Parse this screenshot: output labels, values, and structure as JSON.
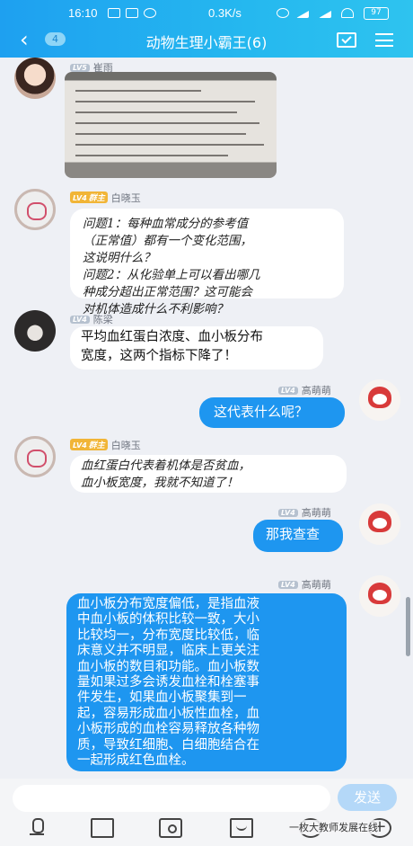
{
  "status_bar": {
    "time": "16:10",
    "network_speed": "0.3K/s",
    "battery": "97"
  },
  "header": {
    "back_icon": "chevron-left-icon",
    "unread_count": "4",
    "title": "动物生理小霸王(6)",
    "calendar_icon": "calendar-check-icon",
    "menu_icon": "menu-icon"
  },
  "messages": [
    {
      "id": "m1",
      "direction": "in",
      "level": "LV5",
      "sender": "崔雨",
      "type": "image"
    },
    {
      "id": "m2",
      "direction": "in",
      "level": "LV4",
      "role": "群主",
      "sender": "白晓玉",
      "lines": [
        "问题1：每种血常成分的参考值",
        "（正常值）都有一个变化范围，",
        "这说明什么？",
        "问题2：从化验单上可以看出哪几",
        "种成分超出正常范围？这可能会",
        "对机体造成什么不利影响？"
      ]
    },
    {
      "id": "m3",
      "direction": "in",
      "level": "LV4",
      "sender": "陈梁",
      "lines": [
        "平均血红蛋白浓度、血小板分布",
        "宽度，这两个指标下降了！"
      ]
    },
    {
      "id": "m4",
      "direction": "out",
      "level": "LV4",
      "sender": "高萌萌",
      "lines": [
        "这代表什么呢？"
      ]
    },
    {
      "id": "m5",
      "direction": "in",
      "level": "LV4",
      "role": "群主",
      "sender": "白晓玉",
      "lines": [
        "血红蛋白代表着机体是否贫血，",
        "血小板宽度，我就不知道了！"
      ]
    },
    {
      "id": "m6",
      "direction": "out",
      "level": "LV4",
      "sender": "高萌萌",
      "lines": [
        "那我查查"
      ]
    },
    {
      "id": "m7",
      "direction": "out",
      "level": "LV4",
      "sender": "高萌萌",
      "lines": [
        "血小板分布宽度偏低，是指血液",
        "中血小板的体积比较一致，大小",
        "比较均一，分布宽度比较低，临",
        "床意义并不明显，临床上更关注",
        "血小板的数目和功能。血小板数",
        "量如果过多会诱发血栓和栓塞事",
        "件发生，如果血小板聚集到一",
        "起，容易形成血小板性血栓，血",
        "小板形成的血栓容易释放各种物",
        "质，导致红细胞、白细胞结合在",
        "一起形成红色血栓。"
      ]
    }
  ],
  "input": {
    "placeholder": "",
    "send_label": "发送"
  },
  "toolbar": {
    "icons": [
      "microphone-icon",
      "image-icon",
      "camera-icon",
      "folder-icon",
      "emoji-icon",
      "plus-icon"
    ]
  },
  "watermark": "一枚大教师发展在线",
  "colors": {
    "header": "#1ea0f0",
    "outgoing_bubble": "#1e96f0",
    "background": "#eef0f5"
  }
}
